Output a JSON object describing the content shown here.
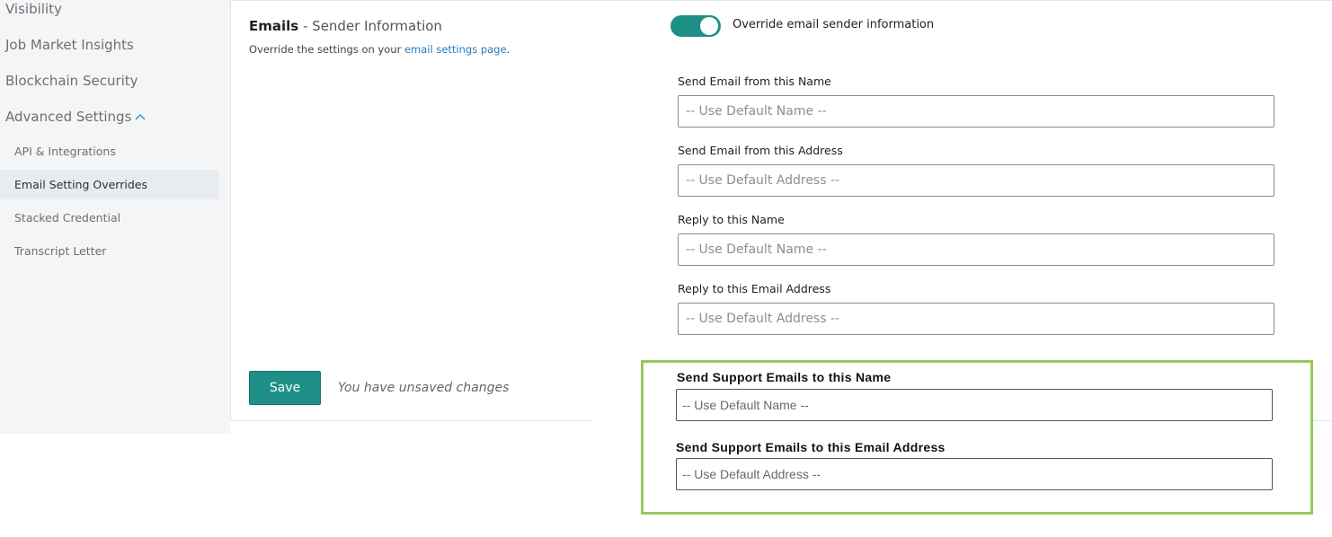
{
  "sidebar": {
    "items": [
      {
        "label": "Visibility"
      },
      {
        "label": "Job Market Insights"
      },
      {
        "label": "Blockchain Security"
      },
      {
        "label": "Advanced Settings"
      }
    ],
    "subitems": [
      {
        "label": "API & Integrations"
      },
      {
        "label": "Email Setting Overrides",
        "active": true
      },
      {
        "label": "Stacked Credential"
      },
      {
        "label": "Transcript Letter"
      }
    ]
  },
  "section": {
    "title_bold": "Emails",
    "title_rest": " - Sender Information",
    "desc_prefix": "Override the settings on your ",
    "desc_link": "email settings page",
    "desc_suffix": "."
  },
  "toggle": {
    "label": "Override email sender information",
    "on": true,
    "color": "#1f9087"
  },
  "fields": [
    {
      "label": "Send Email from this Name",
      "placeholder": "-- Use Default Name --"
    },
    {
      "label": "Send Email from this Address",
      "placeholder": "-- Use Default Address --"
    },
    {
      "label": "Reply to this Name",
      "placeholder": "-- Use Default Name --"
    },
    {
      "label": "Reply to this Email Address",
      "placeholder": "-- Use Default Address --"
    }
  ],
  "support_fields": [
    {
      "label": "Send Support Emails to this Name",
      "placeholder": "-- Use Default Name --"
    },
    {
      "label": "Send Support Emails to this Email Address",
      "placeholder": "-- Use Default Address --"
    }
  ],
  "actions": {
    "save_label": "Save",
    "unsaved_text": "You have unsaved changes"
  },
  "colors": {
    "accent": "#1f9087",
    "link": "#2a7ab8",
    "highlight_border": "#97c95e"
  },
  "icons": {
    "advanced_settings_chevron": "chevron-up-icon"
  }
}
